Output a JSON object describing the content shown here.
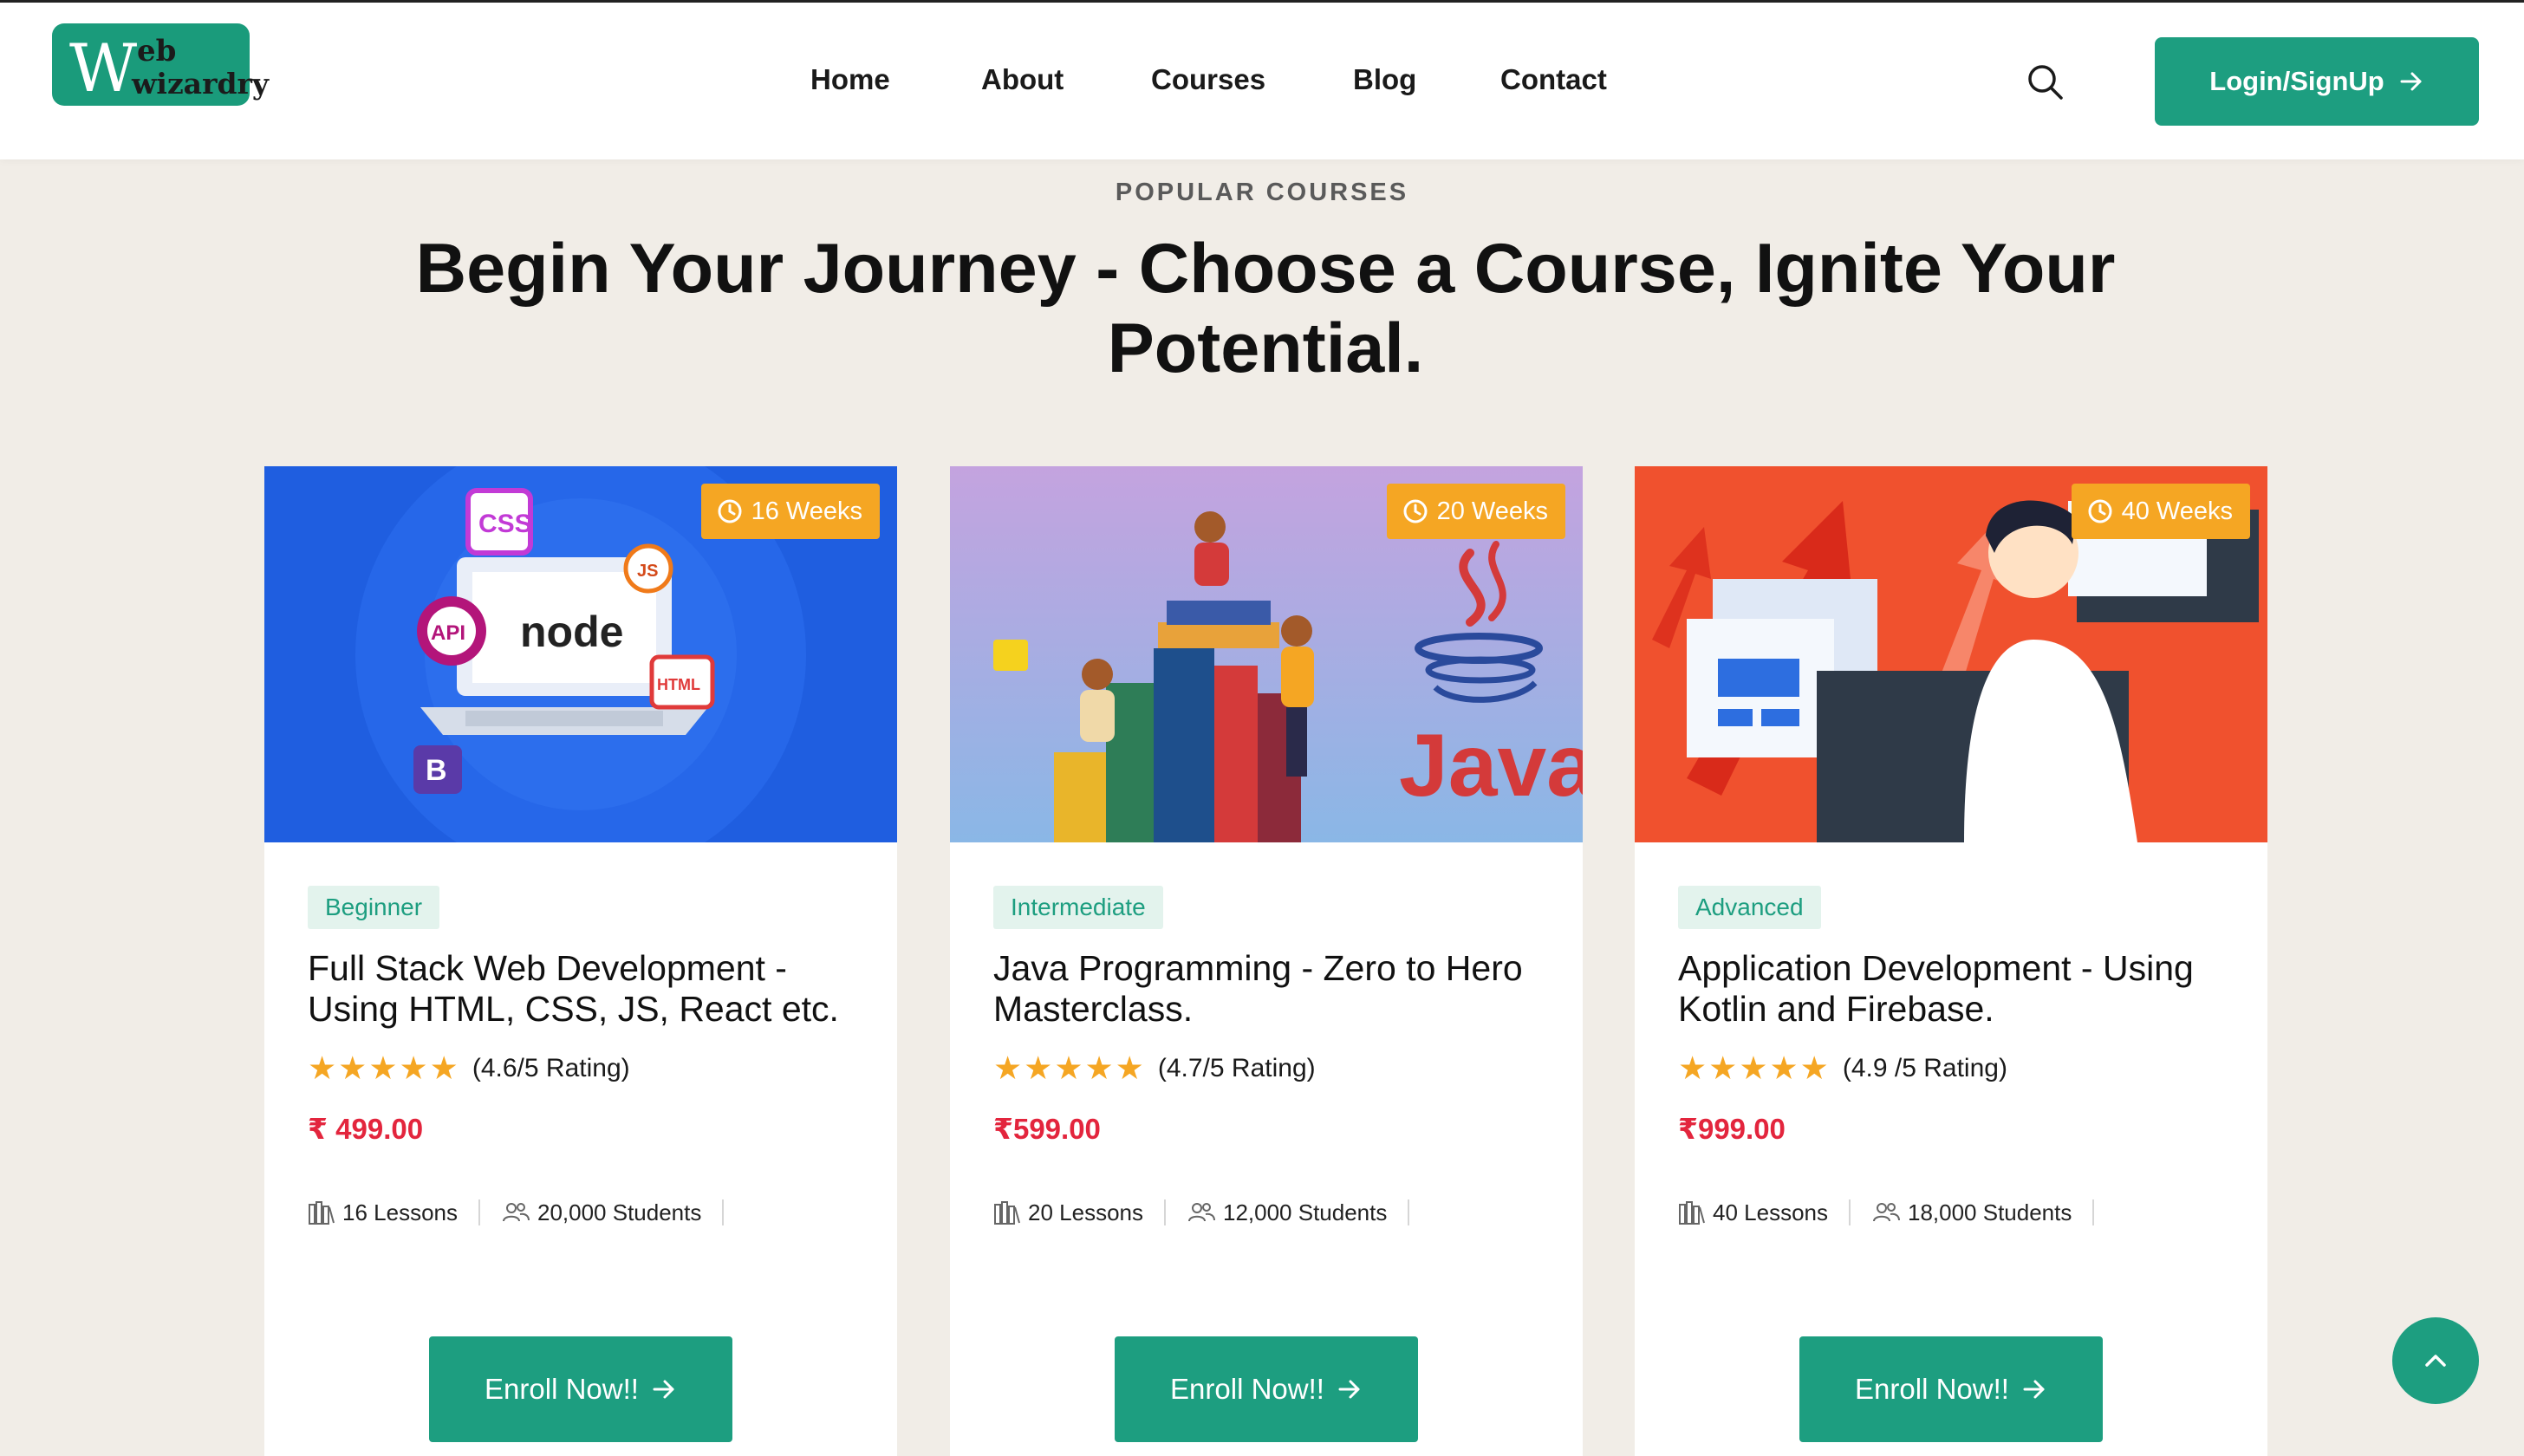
{
  "brand": {
    "logo_w": "W",
    "logo_eb": "eb",
    "logo_wizardry": "wizardry",
    "color": "#1d9e80"
  },
  "nav": {
    "items": [
      "Home",
      "About",
      "Courses",
      "Blog",
      "Contact"
    ]
  },
  "header": {
    "search_icon": "search-icon",
    "login_label": "Login/SignUp"
  },
  "section": {
    "eyebrow": "POPULAR COURSES",
    "title": "Begin Your Journey - Choose a Course, Ignite Your Potential."
  },
  "courses": [
    {
      "duration": "16 Weeks",
      "level": "Beginner",
      "title": "Full Stack Web Development - Using HTML, CSS, JS, React etc.",
      "stars": "★★★★★",
      "rating": "(4.6/5 Rating)",
      "price": "₹ 499.00",
      "lessons": "16 Lessons",
      "students": "20,000 Students",
      "enroll": "Enroll Now!!",
      "image_labels": {
        "css": "CSS",
        "js": "JS",
        "api": "API",
        "node": "node",
        "html": "HTML",
        "bootstrap": "B"
      }
    },
    {
      "duration": "20 Weeks",
      "level": "Intermediate",
      "title": "Java Programming - Zero to Hero Masterclass.",
      "stars": "★★★★★",
      "rating": "(4.7/5 Rating)",
      "price": "₹599.00",
      "lessons": "20 Lessons",
      "students": "12,000 Students",
      "enroll": "Enroll Now!!",
      "image_labels": {
        "java": "Java"
      }
    },
    {
      "duration": "40 Weeks",
      "level": "Advanced",
      "title": "Application Development - Using Kotlin and Firebase.",
      "stars": "★★★★★",
      "rating": "(4.9 /5 Rating)",
      "price": "₹999.00",
      "lessons": "40 Lessons",
      "students": "18,000 Students",
      "enroll": "Enroll Now!!"
    }
  ],
  "colors": {
    "accent": "#1d9e80",
    "badge": "#f5a623",
    "price": "#e3253d",
    "background": "#f1ede7"
  }
}
